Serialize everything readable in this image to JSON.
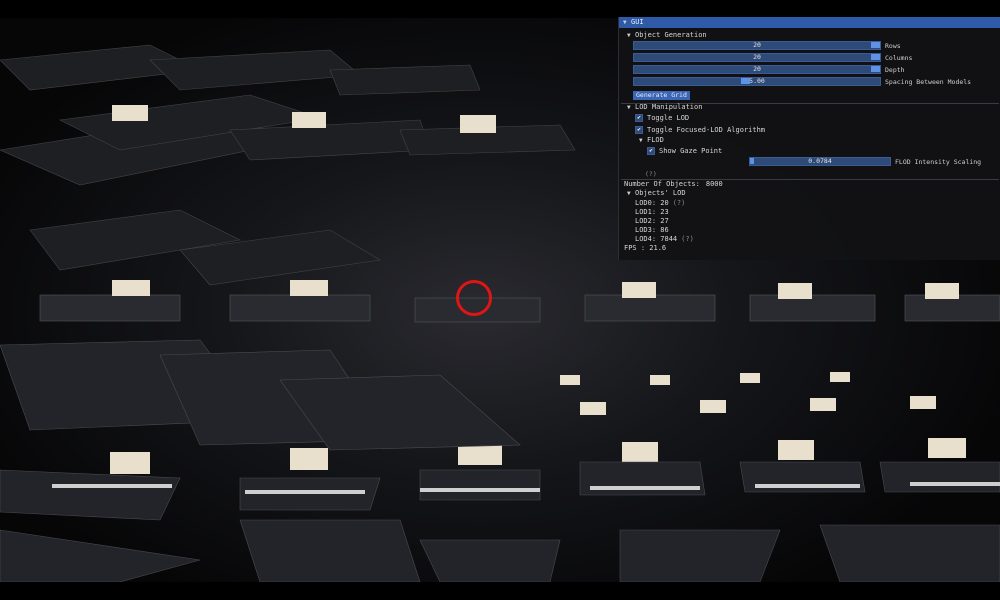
{
  "window": {
    "title": "GUI"
  },
  "object_generation": {
    "header": "Object Generation",
    "rows": {
      "value": "20",
      "label": "Rows",
      "fraction": 0.99
    },
    "columns": {
      "value": "20",
      "label": "Columns",
      "fraction": 0.99
    },
    "depth": {
      "value": "20",
      "label": "Depth",
      "fraction": 0.99
    },
    "spacing": {
      "value": "5.00",
      "label": "Spacing Between Models",
      "fraction": 0.45
    },
    "generate_button": "Generate Grid"
  },
  "lod_manipulation": {
    "header": "LOD Manipulation",
    "toggle_lod": "Toggle LOD",
    "toggle_focused": "Toggle Focused-LOD Algorithm",
    "flod_header": "FLOD",
    "show_gaze": "Show Gaze Point",
    "intensity": {
      "value": "0.0784",
      "label": "FLOD Intensity Scaling",
      "fraction": 0.02
    },
    "help": "(?)"
  },
  "stats": {
    "object_count_label": "Number Of Objects:",
    "object_count": "8000",
    "lod_header": "Objects' LOD",
    "lod0": "LOD0:  20",
    "lod0_help": "(?)",
    "lod1": "LOD1:  23",
    "lod2": "LOD2:  27",
    "lod3": "LOD3:  86",
    "lod4": "LOD4:  7844",
    "lod4_help": "(?)",
    "fps": "FPS :  21.6"
  },
  "colors": {
    "accent": "#2f5aa8",
    "slider": "#2e4a78",
    "grab": "#5d92e6",
    "gaze": "#e01515"
  }
}
